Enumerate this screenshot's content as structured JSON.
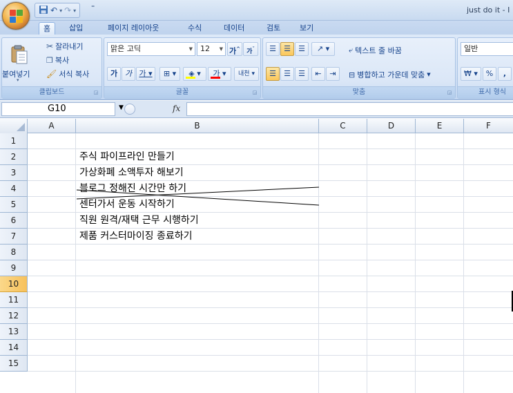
{
  "window": {
    "title": "just do it - I",
    "qat_more": "⁼"
  },
  "ribbon_tabs": [
    "홈",
    "삽입",
    "페이지 레이아웃",
    "수식",
    "데이터",
    "검토",
    "보기"
  ],
  "clipboard": {
    "paste_label": "붙여넣기",
    "cut_label": "잘라내기",
    "copy_label": "복사",
    "format_painter_label": "서식 복사",
    "group_label": "클립보드"
  },
  "font": {
    "font_name": "맑은 고딕",
    "font_size": "12",
    "grow_label": "가",
    "shrink_label": "가",
    "bold_label": "가",
    "italic_label": "가",
    "underline_label": "가",
    "phonetic_label": "내천",
    "fill_color": "#ffff00",
    "font_color": "#ff0000",
    "group_label": "글꼴"
  },
  "alignment": {
    "wrap_text_label": "텍스트 줄 바꿈",
    "merge_center_label": "병합하고 가운데 맞춤",
    "group_label": "맞춤"
  },
  "number": {
    "format_value": "일반",
    "currency_label": "₩",
    "percent_label": "%",
    "comma_label": ",",
    "group_label": "표시 형식"
  },
  "formula_bar": {
    "name_box": "G10",
    "fx": "fx",
    "formula": ""
  },
  "columns": [
    "A",
    "B",
    "C",
    "D",
    "E",
    "F"
  ],
  "rows": [
    "1",
    "2",
    "3",
    "4",
    "5",
    "6",
    "7",
    "8",
    "9",
    "10",
    "11",
    "12",
    "13",
    "14",
    "15"
  ],
  "selected_row": "10",
  "cells": {
    "B2": "주식 파이프라인 만들기",
    "B3": "가상화폐 소액투자 해보기",
    "B4": "블로그 정해진 시간만 하기",
    "B5": "센터가서 운동 시작하기",
    "B6": "직원 원격/재택 근무 시행하기",
    "B7": "제품 커스터마이징 종료하기"
  }
}
